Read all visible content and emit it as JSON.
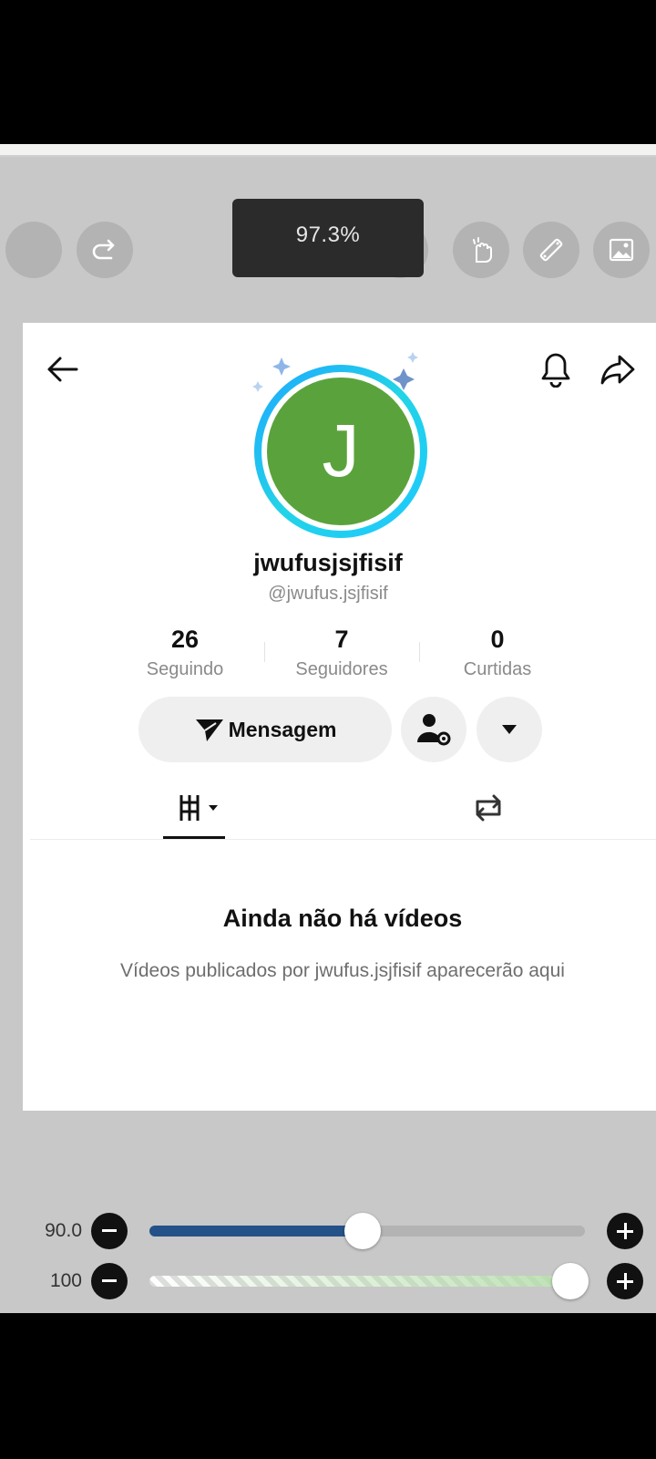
{
  "toolbar": {
    "zoom_text": "97.3%"
  },
  "profile": {
    "avatar_letter": "J",
    "username": "jwufusjsjfisif",
    "handle": "@jwufus.jsjfisif",
    "stats": [
      {
        "value": "26",
        "label": "Seguindo"
      },
      {
        "value": "7",
        "label": "Seguidores"
      },
      {
        "value": "0",
        "label": "Curtidas"
      }
    ],
    "message_button": "Mensagem"
  },
  "empty_state": {
    "title": "Ainda não há vídeos",
    "subtitle": "Vídeos publicados por jwufus.jsjfisif aparecerão aqui"
  },
  "sliders": [
    {
      "value_text": "90.0",
      "fill_fraction": 0.49,
      "color": "#245288"
    },
    {
      "value_text": "100",
      "fill_fraction": 1.0
    }
  ],
  "colors": {
    "accent_ring": "#22d4e6",
    "avatar_bg": "#5aa33c"
  }
}
